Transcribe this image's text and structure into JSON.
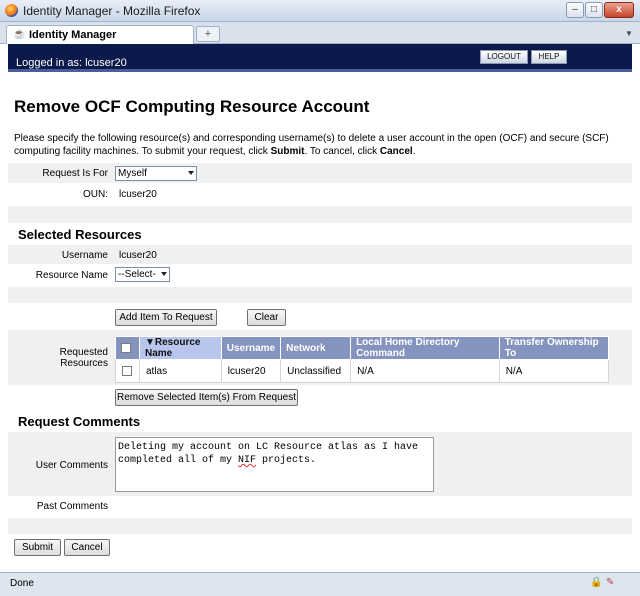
{
  "window": {
    "title": "Identity Manager - Mozilla Firefox",
    "min_label": "–",
    "max_label": "□",
    "close_label": "x"
  },
  "browser": {
    "tab_label": "Identity Manager",
    "new_tab_label": "+",
    "tab_list_label": "▼",
    "status_text": "Done"
  },
  "header": {
    "logged_in": "Logged in as: lcuser20",
    "logout_label": "LOGOUT",
    "help_label": "HELP"
  },
  "page": {
    "title": "Remove OCF Computing Resource Account",
    "intro_pre": "Please specify the following resource(s) and corresponding username(s) to delete a user account in the open (OCF) and secure (SCF) computing facility machines. To submit your request, click ",
    "intro_submit": "Submit",
    "intro_mid": ". To cancel, click ",
    "intro_cancel": "Cancel",
    "intro_end": "."
  },
  "request": {
    "request_for_label": "Request Is For",
    "request_for_value": "Myself",
    "oun_label": "OUN:",
    "oun_value": "lcuser20"
  },
  "selected_resources": {
    "heading": "Selected Resources",
    "username_label": "Username",
    "username_value": "lcuser20",
    "resource_name_label": "Resource Name",
    "resource_name_value": "--Select-",
    "add_button": "Add Item To Request",
    "clear_button": "Clear",
    "requested_label": "Requested Resources",
    "remove_button": "Remove Selected Item(s) From Request"
  },
  "table": {
    "sort_indicator": "▼",
    "headers": [
      "Resource Name",
      "Username",
      "Network",
      "Local Home Directory Command",
      "Transfer Ownership To"
    ],
    "rows": [
      [
        "atlas",
        "lcuser20",
        "Unclassified",
        "N/A",
        "N/A"
      ]
    ]
  },
  "comments": {
    "heading": "Request Comments",
    "user_label": "User Comments",
    "user_text_pre": "Deleting my account on LC Resource atlas as I have\ncompleted all of my ",
    "user_text_word": "NIF",
    "user_text_post": " projects.",
    "past_label": "Past Comments"
  },
  "actions": {
    "submit": "Submit",
    "cancel": "Cancel"
  },
  "icons": {
    "lock": "🔒",
    "addon": "✎"
  }
}
